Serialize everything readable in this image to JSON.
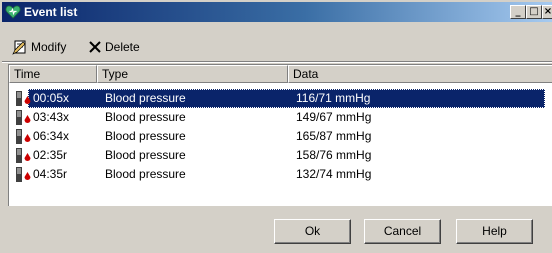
{
  "window": {
    "title": "Event list",
    "minimize_glyph": "_",
    "maximize_glyph": "□",
    "close_glyph": "×"
  },
  "toolbar": {
    "modify_label": "Modify",
    "delete_label": "Delete"
  },
  "columns": [
    "Time",
    "Type",
    "Data"
  ],
  "events": [
    {
      "time": "00:05x",
      "type": "Blood pressure",
      "data": "116/71 mmHg",
      "selected": true
    },
    {
      "time": "03:43x",
      "type": "Blood pressure",
      "data": "149/67 mmHg",
      "selected": false
    },
    {
      "time": "06:34x",
      "type": "Blood pressure",
      "data": "165/87 mmHg",
      "selected": false
    },
    {
      "time": "02:35r",
      "type": "Blood pressure",
      "data": "158/76 mmHg",
      "selected": false
    },
    {
      "time": "04:35r",
      "type": "Blood pressure",
      "data": "132/74 mmHg",
      "selected": false
    }
  ],
  "buttons": {
    "ok": "Ok",
    "cancel": "Cancel",
    "help": "Help"
  },
  "colors": {
    "titlebar_start": "#0a246a",
    "titlebar_end": "#a6caf0",
    "selection": "#0a246a",
    "face": "#d4d0c8",
    "heart": "#3cb371",
    "drop": "#cc0000"
  }
}
